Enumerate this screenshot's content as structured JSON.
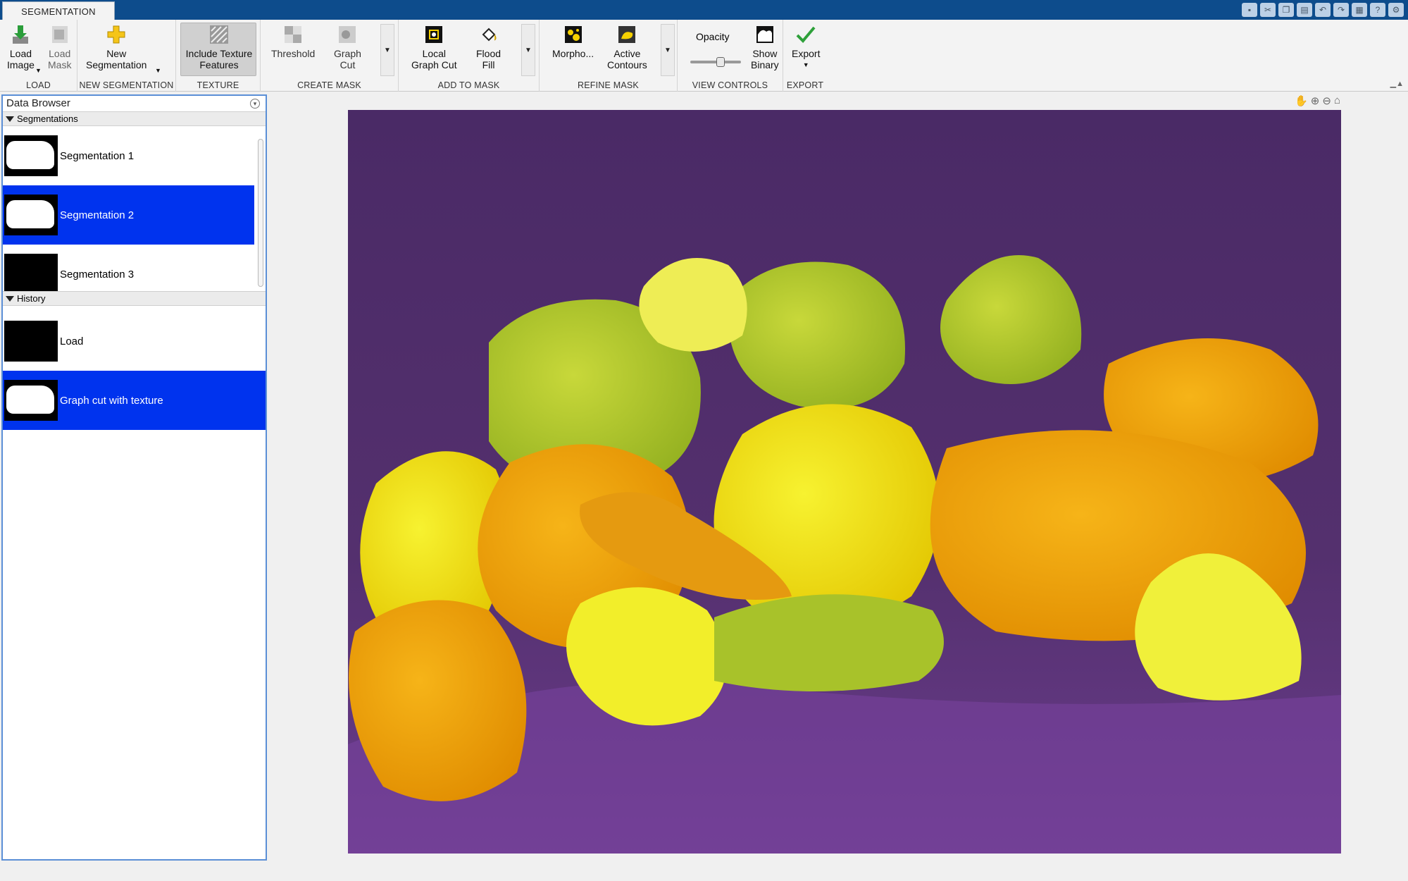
{
  "tab": {
    "label": "SEGMENTATION"
  },
  "colors": {
    "title_bar": "#0d4c8c",
    "selection": "#0033ee",
    "background_cloth": "#4a2a66"
  },
  "ribbon": {
    "load_image": "Load\nImage",
    "load_mask": "Load\nMask",
    "new_segmentation": "New\nSegmentation",
    "include_texture": "Include Texture\nFeatures",
    "threshold": "Threshold",
    "graph_cut": "Graph\nCut",
    "local_graph_cut": "Local\nGraph Cut",
    "flood_fill": "Flood\nFill",
    "morphology": "Morpho...",
    "active_contours": "Active\nContours",
    "opacity": "Opacity",
    "show_binary": "Show\nBinary",
    "export": "Export",
    "groups": {
      "load": "LOAD",
      "new_segmentation": "NEW SEGMENTATION",
      "texture": "TEXTURE",
      "create_mask": "CREATE MASK",
      "add_to_mask": "ADD TO MASK",
      "refine_mask": "REFINE MASK",
      "view_controls": "VIEW CONTROLS",
      "export": "EXPORT"
    }
  },
  "browser": {
    "title": "Data Browser",
    "segmentations_header": "Segmentations",
    "segmentations": [
      {
        "label": "Segmentation 1",
        "selected": false,
        "mask": "blob"
      },
      {
        "label": "Segmentation 2",
        "selected": true,
        "mask": "blob"
      },
      {
        "label": "Segmentation 3",
        "selected": false,
        "mask": "empty"
      }
    ],
    "history_header": "History",
    "history": [
      {
        "label": "Load",
        "selected": false,
        "mask": "empty"
      },
      {
        "label": "Graph cut with texture",
        "selected": true,
        "mask": "blob"
      }
    ]
  },
  "view": {
    "opacity": 0.6
  }
}
